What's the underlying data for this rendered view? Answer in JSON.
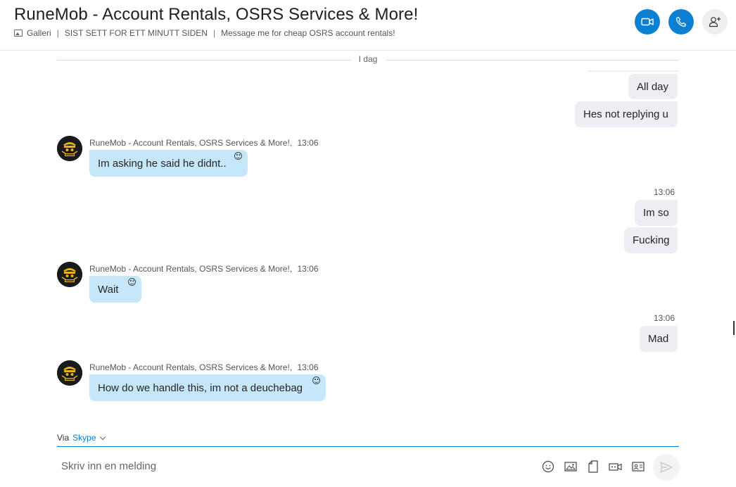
{
  "header": {
    "title": "RuneMob - Account Rentals, OSRS Services & More!",
    "gallery_label": "Galleri",
    "last_seen": "SIST SETT FOR ETT MINUTT SIDEN",
    "mood": "Message me for cheap OSRS account rentals!",
    "buttons": [
      {
        "name": "video-call-button",
        "icon": "video-camera-icon",
        "color": "#0b7fd1"
      },
      {
        "name": "audio-call-button",
        "icon": "phone-icon",
        "color": "#0b7fd1"
      },
      {
        "name": "add-people-button",
        "icon": "add-person-icon",
        "color": "#eeeeee"
      }
    ]
  },
  "divider": {
    "label": "I dag"
  },
  "messages": {
    "m1": {
      "text": "All day"
    },
    "m2": {
      "text": "Hes not replying u"
    },
    "m3": {
      "sender": "RuneMob - Account Rentals, OSRS Services & More!,",
      "time": "13:06",
      "text": "Im asking he said he didnt.."
    },
    "m4": {
      "time": "13:06",
      "text": "Im so"
    },
    "m5": {
      "text": "Fucking"
    },
    "m6": {
      "sender": "RuneMob - Account Rentals, OSRS Services & More!,",
      "time": "13:06",
      "text": "Wait"
    },
    "m7": {
      "time": "13:06",
      "text": "Mad"
    },
    "m8": {
      "sender": "RuneMob - Account Rentals, OSRS Services & More!,",
      "time": "13:06",
      "text": "How do we handle this, im not a deuchebag"
    }
  },
  "footer": {
    "via_label": "Via",
    "via_service": "Skype",
    "placeholder": "Skriv inn en melding",
    "tools": [
      "emoji-icon",
      "image-icon",
      "file-icon",
      "video-message-icon",
      "contact-card-icon"
    ],
    "send_icon": "send-icon"
  },
  "colors": {
    "accent": "#0b7fd1",
    "incoming_bubble": "#c6e7fa",
    "outgoing_bubble": "#eceef3"
  }
}
